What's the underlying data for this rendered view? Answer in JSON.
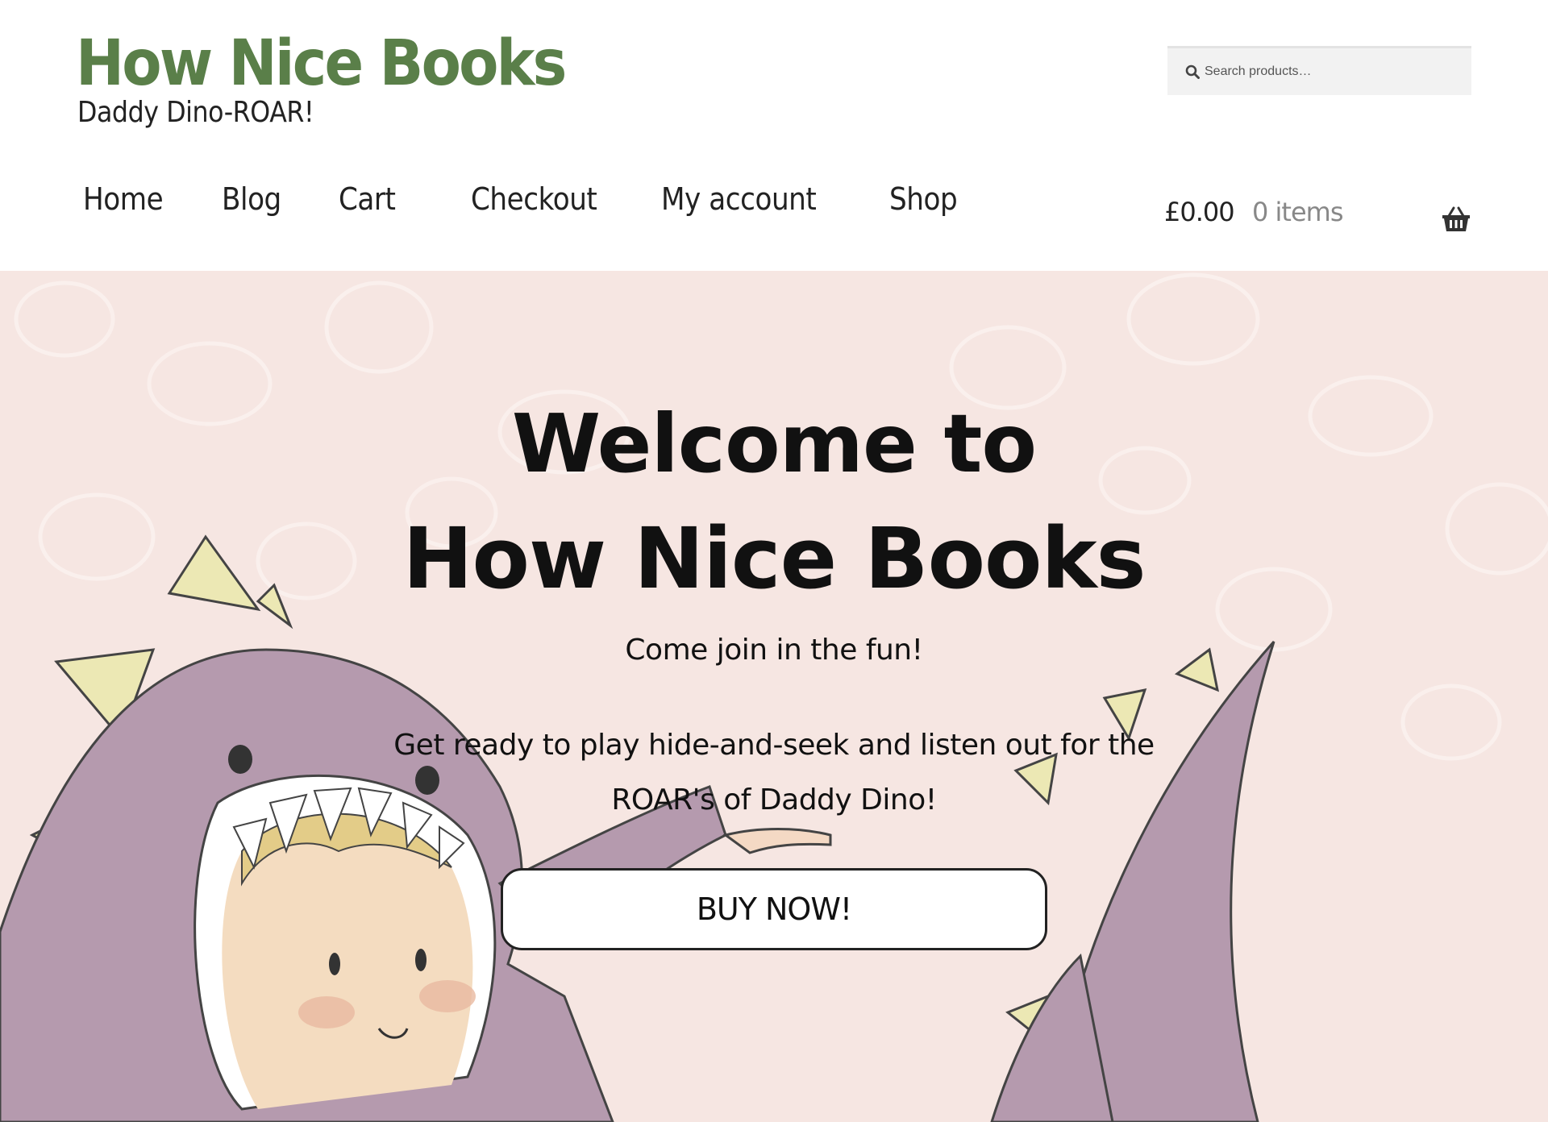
{
  "header": {
    "site_title": "How Nice Books",
    "tagline": "Daddy Dino-ROAR!"
  },
  "search": {
    "placeholder": "Search products…",
    "icon": "search-icon"
  },
  "nav": {
    "items": [
      {
        "label": "Home"
      },
      {
        "label": "Blog"
      },
      {
        "label": "Cart"
      },
      {
        "label": "Checkout"
      },
      {
        "label": "My account"
      },
      {
        "label": "Shop"
      }
    ]
  },
  "cart": {
    "total": "£0.00",
    "count": "0 items",
    "icon": "basket-icon"
  },
  "hero": {
    "heading_line1": "Welcome to",
    "heading_line2": "How Nice Books",
    "subtitle": "Come join in the fun!",
    "text": "Get ready to play hide-and-seek and listen out for the ROAR's of Daddy Dino!",
    "button_label": "BUY NOW!"
  },
  "colors": {
    "brand_green": "#5a7f49",
    "hero_background": "#f6e6e2",
    "dino_purple": "#b59aae",
    "spike_yellow": "#ece8b4"
  }
}
